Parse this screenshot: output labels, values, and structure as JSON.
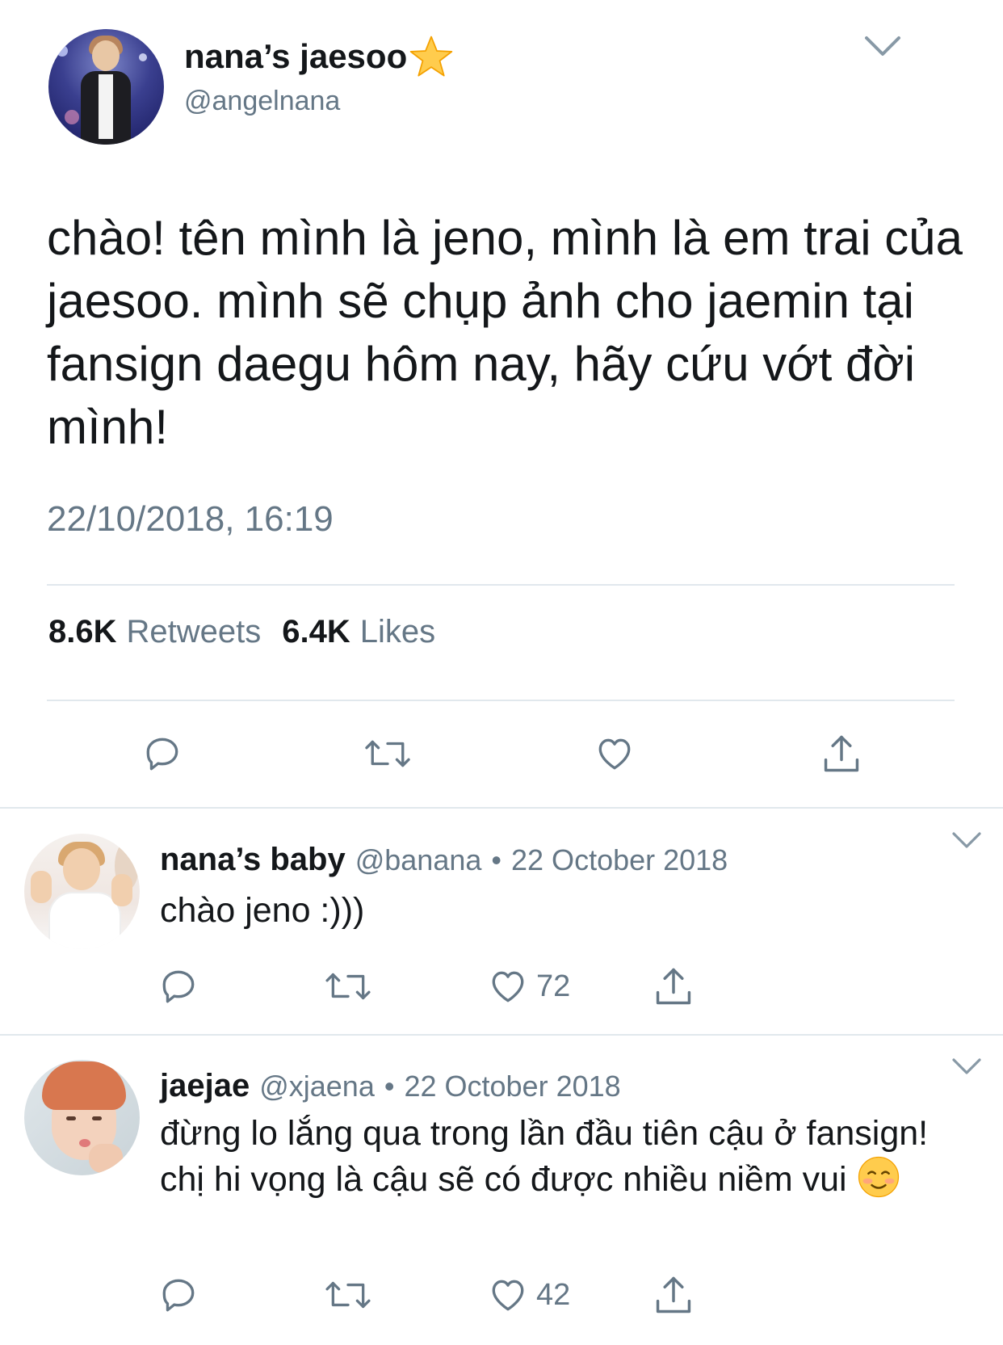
{
  "main_tweet": {
    "display_name": "nana’s jaesoo",
    "handle": "@angelnana",
    "text": "chào! tên mình là jeno, mình là em trai của jaesoo. mình sẽ chụp ảnh cho jaemin tại fansign daegu hôm nay, hãy cứu vớt đời mình!",
    "timestamp": "22/10/2018, 16:19",
    "retweets_count": "8.6K",
    "retweets_label": "Retweets",
    "likes_count": "6.4K",
    "likes_label": "Likes",
    "icons": {
      "name_badge": "star-icon",
      "more": "chevron-down-icon",
      "actions": [
        "reply-icon",
        "retweet-icon",
        "like-icon",
        "share-icon"
      ]
    }
  },
  "replies": [
    {
      "display_name": "nana’s baby",
      "handle": "@banana",
      "separator": "•",
      "date": "22 October 2018",
      "text": "chào jeno :)))",
      "like_count": "72"
    },
    {
      "display_name": "jaejae",
      "handle": "@xjaena",
      "separator": "•",
      "date": "22 October 2018",
      "text": "đừng lo lắng qua trong lần đầu tiên cậu ở fansign! chị hi vọng là cậu sẽ có được nhiều niềm vui",
      "emoji": "smiling-face-emoji",
      "like_count": "42"
    }
  ],
  "colors": {
    "text_primary": "#14171a",
    "text_secondary": "#657786",
    "divider": "#e1e8ed",
    "icon": "#657786",
    "star": "#ffcc4d"
  }
}
